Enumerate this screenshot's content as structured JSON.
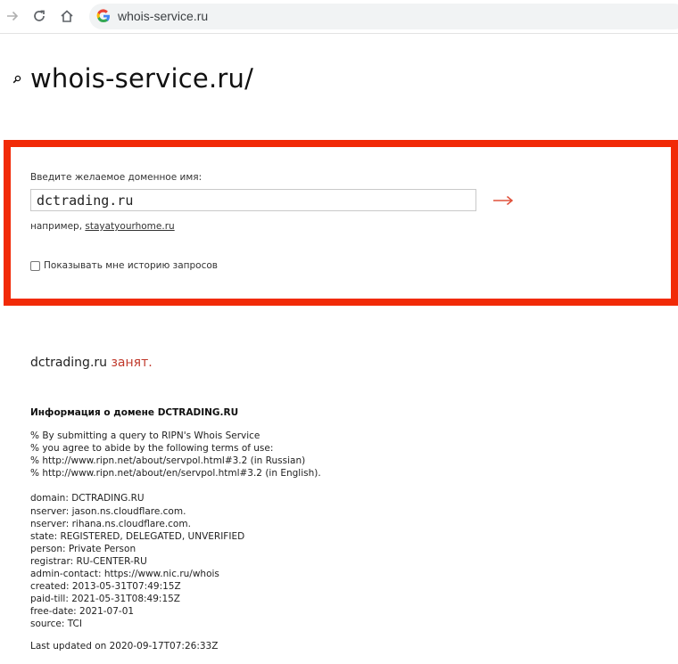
{
  "browser": {
    "url": "whois-service.ru"
  },
  "page": {
    "title": "whois-service.ru/"
  },
  "search": {
    "prompt": "Введите желаемое доменное имя:",
    "value": "dctrading.ru",
    "example_prefix": "например,",
    "example_link": "stayatyourhome.ru",
    "history_label": "Показывать мне историю запросов",
    "highlight_color": "#f12a07"
  },
  "result": {
    "domain": "dctrading.ru",
    "status": "занят",
    "status_suffix": "."
  },
  "info": {
    "heading": "Информация о домене DCTRADING.RU",
    "lines": [
      "% By submitting a query to RIPN's Whois Service",
      "% you agree to abide by the following terms of use:",
      "% http://www.ripn.net/about/servpol.html#3.2 (in Russian)",
      "% http://www.ripn.net/about/en/servpol.html#3.2 (in English).",
      "",
      "domain: DCTRADING.RU",
      "nserver: jason.ns.cloudflare.com.",
      "nserver: rihana.ns.cloudflare.com.",
      "state: REGISTERED, DELEGATED, UNVERIFIED",
      "person: Private Person",
      "registrar: RU-CENTER-RU",
      "admin-contact: https://www.nic.ru/whois",
      "created: 2013-05-31T07:49:15Z",
      "paid-till: 2021-05-31T08:49:15Z",
      "free-date: 2021-07-01",
      "source: TCI"
    ],
    "last_updated": "Last updated on 2020-09-17T07:26:33Z"
  }
}
